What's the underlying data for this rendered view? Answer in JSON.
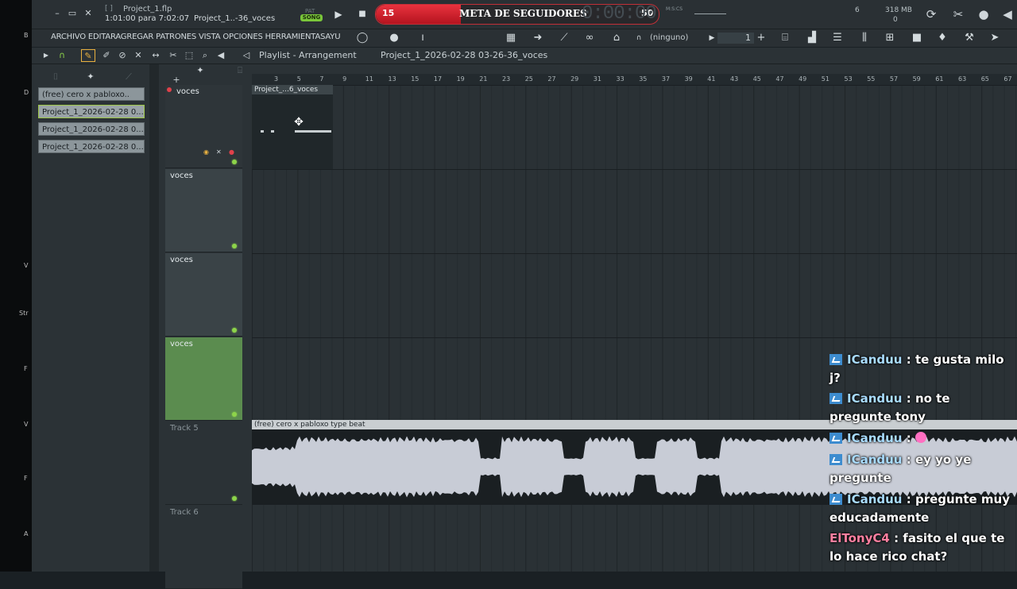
{
  "desktop": {
    "labels": [
      "B",
      "D",
      "V",
      "Str",
      "F",
      "V",
      "F",
      "A"
    ]
  },
  "window": {
    "title_file": "Project_1.flp",
    "title_bracket": "[ ]",
    "time_text": "1:01:00 para 7:02:07",
    "project_short": "Project_1..-36_voces",
    "minimize": "–",
    "restore": "▭",
    "close": "✕"
  },
  "transport": {
    "pat_label": "PAT",
    "song_label": "SONG",
    "play": "▶",
    "stop": "■"
  },
  "goal_overlay": {
    "title": "META DE SEGUIDORES",
    "current": "15",
    "target": "50",
    "progress": 0.3
  },
  "clock": {
    "time": "0:00:00",
    "tag": "M:S:CS"
  },
  "cpu": {
    "value1": "6",
    "memory": "318 MB",
    "value2": "0"
  },
  "menu": {
    "text": "ARCHIVO EDITARAGREGAR PATRONES VISTA OPCIONES HERRAMIENTASAYU",
    "ninguno": "(ninguno)",
    "pattern_number": "1",
    "plus": "+"
  },
  "playlist": {
    "title": "Playlist - Arrangement",
    "subtitle": "Project_1_2026-02-28 03-26-36_voces"
  },
  "picker": {
    "items": [
      {
        "label": "(free) cero x pabloxo..",
        "selected": false
      },
      {
        "label": "Project_1_2026-02-28 0...",
        "selected": true
      },
      {
        "label": "Project_1_2026-02-28 0...",
        "selected": false
      },
      {
        "label": "Project_1_2026-02-28 0...",
        "selected": false
      }
    ]
  },
  "ruler": {
    "numbers": [
      "3",
      "5",
      "7",
      "9",
      "11",
      "13",
      "15",
      "17",
      "19",
      "21",
      "23",
      "25",
      "27",
      "29",
      "31",
      "33",
      "35",
      "37",
      "39",
      "41",
      "43",
      "45",
      "47",
      "49",
      "51",
      "53",
      "55",
      "57",
      "59",
      "61",
      "63",
      "65",
      "67"
    ]
  },
  "tracks": [
    {
      "name": "voces",
      "style": "dark"
    },
    {
      "name": "voces",
      "style": "normal"
    },
    {
      "name": "voces",
      "style": "normal"
    },
    {
      "name": "voces",
      "style": "green"
    },
    {
      "name": "Track 5",
      "style": "dim"
    },
    {
      "name": "Track 6",
      "style": "dim"
    }
  ],
  "clips": {
    "pattern_clip": "Project_...6_voces",
    "audio_clip": "(free) cero x pabloxo type beat"
  },
  "chat": [
    {
      "user": "ICanduu",
      "text": ": te gusta milo j?"
    },
    {
      "user": "ICanduu",
      "text": ": no te pregunte tony"
    },
    {
      "user": "ICanduu",
      "text": ":"
    },
    {
      "user": "ICanduu",
      "text": ": ey yo ye pregunte"
    },
    {
      "user": "ICanduu",
      "text": ": pregunte muy educadamente"
    },
    {
      "user": "ElTonyC4",
      "text": ": fasito el que te lo hace rico chat?"
    }
  ]
}
